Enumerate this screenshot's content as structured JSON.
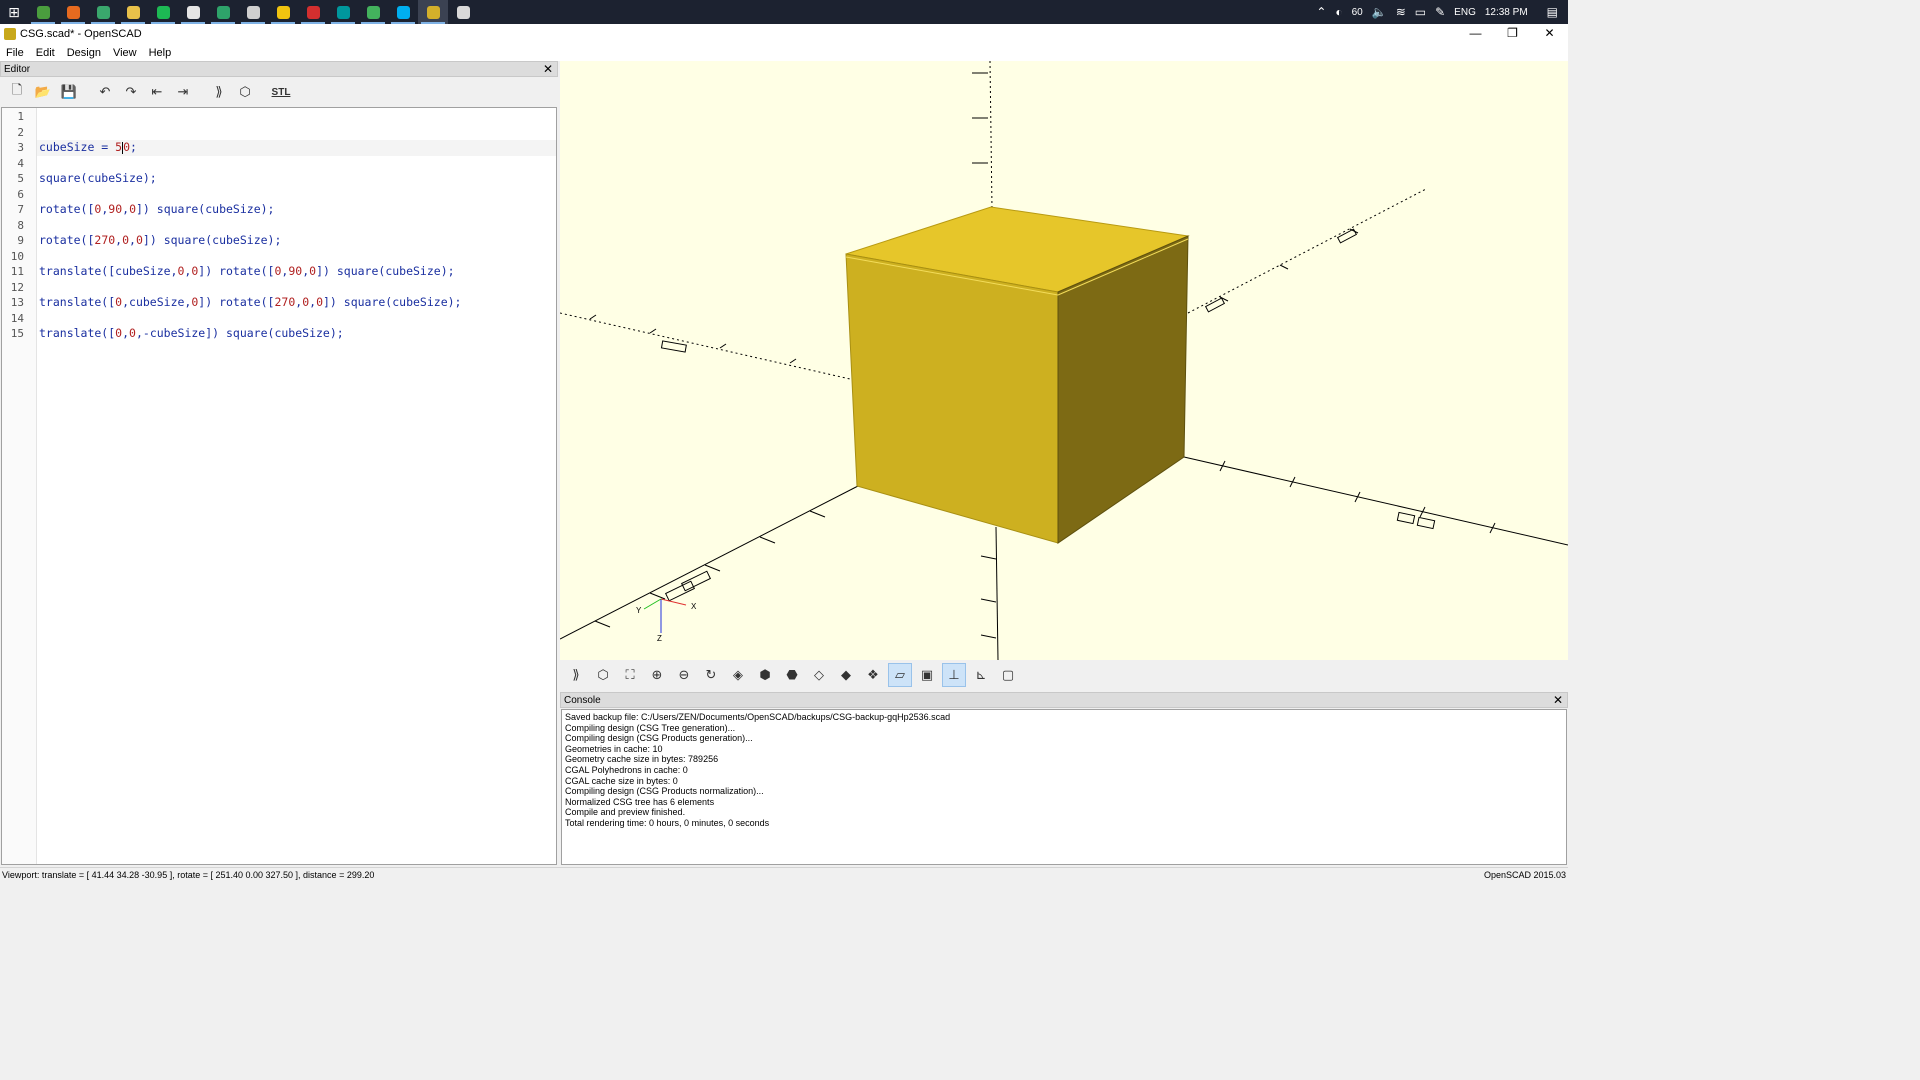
{
  "taskbar": {
    "apps": [
      {
        "name": "word-app",
        "color": "#4a9d3e"
      },
      {
        "name": "firefox-app",
        "color": "#e66a1f"
      },
      {
        "name": "app-green",
        "color": "#3aa76d"
      },
      {
        "name": "file-explorer-app",
        "color": "#e8c14a"
      },
      {
        "name": "spotify-app",
        "color": "#1db954"
      },
      {
        "name": "git-app",
        "color": "#e5e5e5"
      },
      {
        "name": "green-arrow-app",
        "color": "#2ea36a"
      },
      {
        "name": "media-app",
        "color": "#cfcfcf"
      },
      {
        "name": "sticky-notes-app",
        "color": "#f1c40f"
      },
      {
        "name": "acrobat-app",
        "color": "#d32f2f"
      },
      {
        "name": "arduino-app",
        "color": "#00979d"
      },
      {
        "name": "green-app",
        "color": "#43b25d"
      },
      {
        "name": "skype-app",
        "color": "#00aff0"
      },
      {
        "name": "openscad-app",
        "color": "#d4b02a"
      },
      {
        "name": "chrome-app",
        "color": "#d9d9d9"
      }
    ],
    "tray": {
      "battery": "60",
      "language": "ENG",
      "time": "12:38 PM"
    }
  },
  "window": {
    "title": "CSG.scad* - OpenSCAD",
    "menu": [
      "File",
      "Edit",
      "Design",
      "View",
      "Help"
    ]
  },
  "editor": {
    "panel_title": "Editor",
    "line_numbers": [
      "1",
      "2",
      "3",
      "4",
      "5",
      "6",
      "7",
      "8",
      "9",
      "10",
      "11",
      "12",
      "13",
      "14",
      "15"
    ],
    "lines": [
      "",
      "",
      "cubeSize = 50;",
      "",
      "square(cubeSize);",
      "",
      "rotate([0,90,0]) square(cubeSize);",
      "",
      "rotate([270,0,0]) square(cubeSize);",
      "",
      "translate([cubeSize,0,0]) rotate([0,90,0]) square(cubeSize);",
      "",
      "translate([0,cubeSize,0]) rotate([270,0,0]) square(cubeSize);",
      "",
      "translate([0,0,-cubeSize]) square(cubeSize);"
    ],
    "stl_label": "STL"
  },
  "viewport": {
    "colors": {
      "background": "#ffffe5",
      "cube_top": "#e6c62a",
      "cube_front": "#cdb020",
      "cube_side": "#7d6a14"
    },
    "axis_labels": {
      "x": "X",
      "y": "Y",
      "z": "Z"
    }
  },
  "console": {
    "panel_title": "Console",
    "lines": [
      "Saved backup file: C:/Users/ZEN/Documents/OpenSCAD/backups/CSG-backup-gqHp2536.scad",
      "Compiling design (CSG Tree generation)...",
      "Compiling design (CSG Products generation)...",
      "Geometries in cache: 10",
      "Geometry cache size in bytes: 789256",
      "CGAL Polyhedrons in cache: 0",
      "CGAL cache size in bytes: 0",
      "Compiling design (CSG Products normalization)...",
      "Normalized CSG tree has 6 elements",
      "Compile and preview finished.",
      "Total rendering time: 0 hours, 0 minutes, 0 seconds"
    ]
  },
  "status": {
    "viewport_info": "Viewport: translate = [ 41.44 34.28 -30.95 ], rotate = [ 251.40 0.00 327.50 ], distance = 299.20",
    "version": "OpenSCAD 2015.03"
  }
}
